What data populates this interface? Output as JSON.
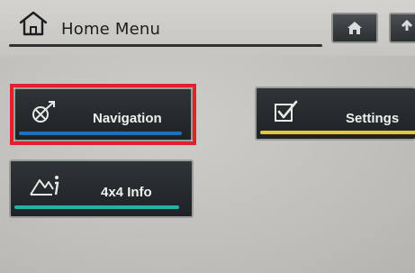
{
  "header": {
    "title": "Home Menu",
    "home_button": "home-icon",
    "back_button": "back-icon"
  },
  "tiles": {
    "navigation": {
      "label": "Navigation",
      "accent": "#1f6fc0",
      "icon": "navigation-icon",
      "selected": true
    },
    "settings": {
      "label": "Settings",
      "accent": "#e3c83a",
      "icon": "checkbox-icon"
    },
    "info4x4": {
      "label": "4x4 Info",
      "accent": "#1fb5a5",
      "icon": "mountain-info-icon"
    }
  },
  "colors": {
    "selection": "#e0222c",
    "tile_bg": "#24292b"
  }
}
